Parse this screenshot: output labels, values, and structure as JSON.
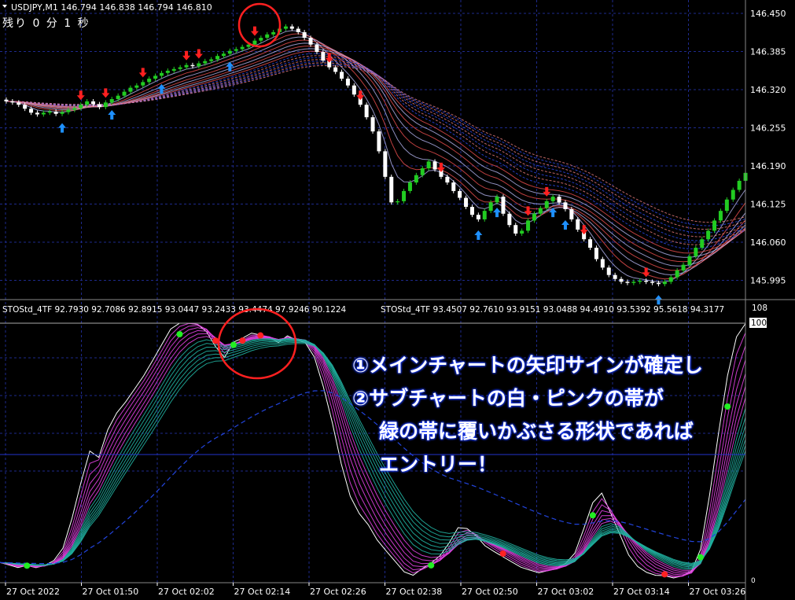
{
  "main_chart": {
    "header": "USDJPY,M1  146.794 146.838 146.794 146.810",
    "timer": "残り 0 分 1 秒",
    "price_ticks": [
      "146.450",
      "146.385",
      "146.320",
      "146.255",
      "146.190",
      "146.125",
      "146.060",
      "145.995"
    ]
  },
  "sub_chart": {
    "header_left": "STOStd_4TF 92.7930 92.7086 92.8915 93.0447 93.2433 93.4474 97.9246 90.1224",
    "header_right": "STOStd_4TF 93.4507 92.7610 93.9151 93.0488 94.4910 93.5392 95.5618 94.3177",
    "scale_max": "108",
    "level_label": "100",
    "zero_label": "0"
  },
  "time_axis": [
    "27 Oct 2022",
    "27 Oct 01:50",
    "27 Oct 02:02",
    "27 Oct 02:14",
    "27 Oct 02:26",
    "27 Oct 02:38",
    "27 Oct 02:50",
    "27 Oct 03:02",
    "27 Oct 03:14",
    "27 Oct 03:26"
  ],
  "annotation": {
    "line1": "①メインチャートの矢印サインが確定し",
    "line2": "②サブチャートの白・ピンクの帯が",
    "line3": "緑の帯に覆いかぶさる形状であれば",
    "line4": "エントリー！"
  },
  "colors": {
    "background": "#000000",
    "grid": "#1e2a8c",
    "bull": "#22cc22",
    "bear": "#ffffff",
    "up_arrow": "#1e90ff",
    "down_arrow": "#ff2020",
    "pink": "#e040e0",
    "teal": "#20b0a0",
    "circle": "#ff2020"
  },
  "chart_data": [
    {
      "type": "candlestick",
      "title": "USDJPY,M1",
      "ylim": [
        145.97,
        146.48
      ],
      "x_count": 120,
      "close": [
        146.318,
        146.316,
        146.312,
        146.305,
        146.298,
        146.295,
        146.298,
        146.3,
        146.296,
        146.299,
        146.303,
        146.306,
        146.312,
        146.318,
        146.313,
        146.308,
        146.316,
        146.322,
        146.328,
        146.335,
        146.342,
        146.346,
        146.352,
        146.358,
        146.363,
        146.368,
        146.372,
        146.375,
        146.378,
        146.382,
        146.38,
        146.385,
        146.389,
        146.392,
        146.398,
        146.402,
        146.407,
        146.41,
        146.414,
        146.418,
        146.425,
        146.43,
        146.436,
        146.44,
        146.446,
        146.45,
        146.446,
        146.44,
        146.43,
        146.418,
        146.405,
        146.39,
        146.378,
        146.37,
        146.358,
        146.346,
        146.33,
        146.312,
        146.29,
        146.265,
        146.23,
        146.185,
        146.14,
        146.142,
        146.16,
        146.175,
        146.188,
        146.2,
        146.212,
        146.198,
        146.185,
        146.175,
        146.16,
        146.148,
        146.132,
        146.118,
        146.11,
        146.125,
        146.14,
        146.15,
        146.12,
        146.1,
        146.085,
        146.09,
        146.108,
        146.12,
        146.13,
        146.142,
        146.15,
        146.14,
        146.128,
        146.11,
        146.092,
        146.075,
        146.06,
        146.04,
        146.025,
        146.012,
        146.005,
        146.0,
        145.998,
        146.0,
        146.002,
        146.0,
        145.998,
        145.996,
        146.0,
        146.008,
        146.02,
        146.03,
        146.045,
        146.06,
        146.075,
        146.09,
        146.108,
        146.125,
        146.145,
        146.162,
        146.178,
        146.192
      ]
    },
    {
      "type": "line",
      "title": "STOStd_4TF",
      "ylim": [
        0,
        108
      ],
      "series": [
        {
          "values": [
            8,
            7,
            6,
            7,
            6,
            7,
            9,
            14,
            26,
            40,
            52,
            48,
            60,
            66,
            70,
            75,
            80,
            86,
            92,
            98,
            100,
            100,
            99,
            96,
            90,
            86,
            93,
            94,
            96,
            95,
            94,
            92,
            95,
            93,
            92,
            86,
            74,
            60,
            44,
            32,
            26,
            22,
            16,
            12,
            8,
            4,
            3,
            6,
            8,
            11,
            16,
            22,
            21,
            18,
            14,
            12,
            10,
            8,
            6,
            5,
            4,
            5,
            6,
            8,
            12,
            22,
            32,
            35,
            26,
            18,
            10,
            6,
            4,
            3,
            3,
            2,
            3,
            5,
            14,
            36,
            60,
            82,
            96,
            100
          ]
        }
      ]
    }
  ]
}
